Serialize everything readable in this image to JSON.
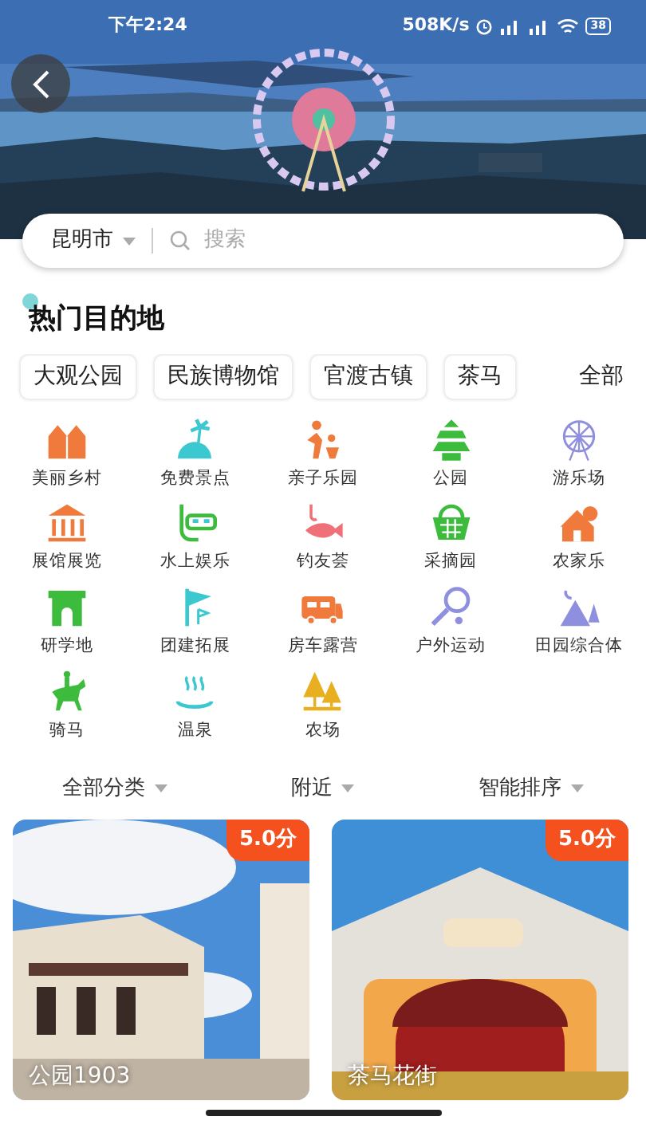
{
  "status_bar": {
    "time": "下午2:24",
    "net_speed": "508K/s",
    "battery": "38"
  },
  "city_selector": {
    "value": "昆明市"
  },
  "search": {
    "placeholder": "搜索"
  },
  "hot_destinations": {
    "title": "热门目的地",
    "all_link": "全部",
    "chips": [
      {
        "label": "大观公园"
      },
      {
        "label": "民族博物馆"
      },
      {
        "label": "官渡古镇"
      },
      {
        "label": "茶马"
      }
    ]
  },
  "categories": [
    {
      "label": "美丽乡村"
    },
    {
      "label": "免费景点"
    },
    {
      "label": "亲子乐园"
    },
    {
      "label": "公园"
    },
    {
      "label": "游乐场"
    },
    {
      "label": "展馆展览"
    },
    {
      "label": "水上娱乐"
    },
    {
      "label": "钓友荟"
    },
    {
      "label": "采摘园"
    },
    {
      "label": "农家乐"
    },
    {
      "label": "研学地"
    },
    {
      "label": "团建拓展"
    },
    {
      "label": "房车露营"
    },
    {
      "label": "户外运动"
    },
    {
      "label": "田园综合体"
    },
    {
      "label": "骑马"
    },
    {
      "label": "温泉"
    },
    {
      "label": "农场"
    }
  ],
  "filters": [
    {
      "label": "全部分类"
    },
    {
      "label": "附近"
    },
    {
      "label": "智能排序"
    }
  ],
  "cards": [
    {
      "title": "公园1903",
      "score": "5.0分"
    },
    {
      "title": "茶马花街",
      "score": "5.0分"
    }
  ]
}
